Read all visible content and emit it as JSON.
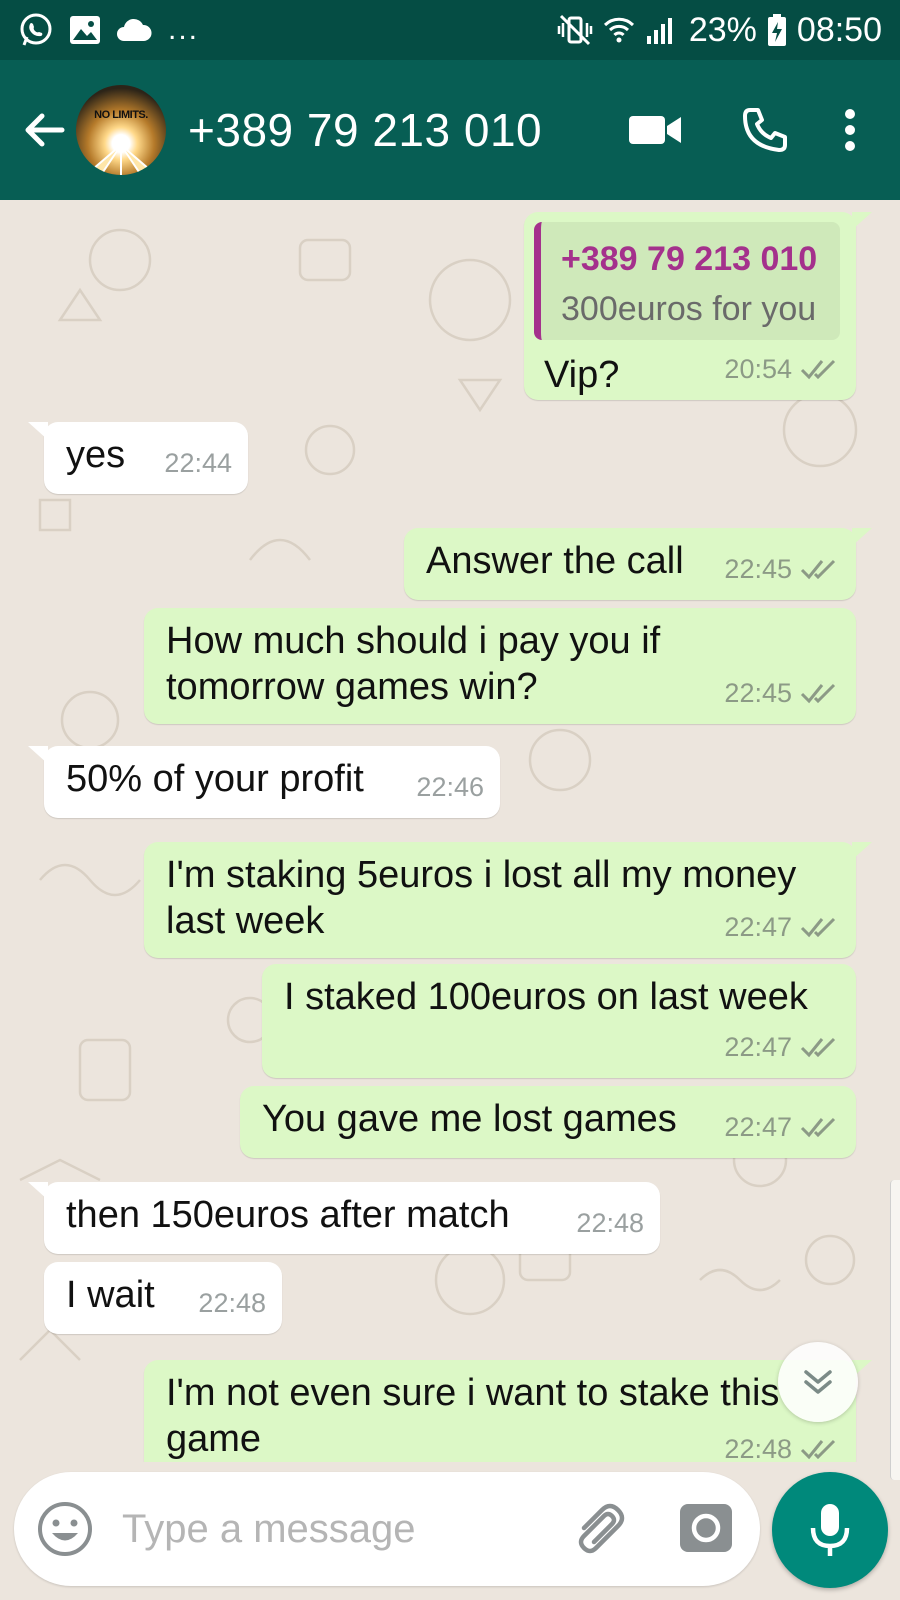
{
  "status_bar": {
    "left_icons": [
      "whatsapp-icon",
      "image-icon",
      "cloud-icon"
    ],
    "more": "...",
    "battery": "23%",
    "time": "08:50",
    "right_icons": [
      "mute-vibrate-icon",
      "wifi-icon",
      "signal-icon",
      "battery-charging-icon"
    ]
  },
  "header": {
    "back_icon": "arrow-left-icon",
    "avatar_text": "NO LIMITS.",
    "contact": "+389 79 213 010",
    "actions": [
      "video-call-icon",
      "phone-icon",
      "more-vert-icon"
    ]
  },
  "messages": [
    {
      "dir": "out",
      "quote": {
        "author": "+389 79 213 010",
        "text": "300euros for you"
      },
      "text": "Vip?",
      "time": "20:54",
      "ticks": true
    },
    {
      "dir": "in",
      "text": "yes",
      "time": "22:44"
    },
    {
      "dir": "out",
      "text": "Answer the call",
      "time": "22:45",
      "ticks": true
    },
    {
      "dir": "out",
      "text": "How much should i pay you if\ntomorrow games win?",
      "time": "22:45",
      "ticks": true
    },
    {
      "dir": "in",
      "text": "50% of your profit",
      "time": "22:46"
    },
    {
      "dir": "out",
      "text": "I'm staking 5euros i lost all my money\nlast week",
      "time": "22:47",
      "ticks": true
    },
    {
      "dir": "out",
      "text": "I staked 100euros on last week",
      "time": "22:47",
      "ticks": true
    },
    {
      "dir": "out",
      "text": "You gave me lost games",
      "time": "22:47",
      "ticks": true
    },
    {
      "dir": "in",
      "text": "then 150euros after match",
      "time": "22:48"
    },
    {
      "dir": "in",
      "text": "I wait",
      "time": "22:48"
    },
    {
      "dir": "out",
      "text": "I'm not even sure i want to stake this\ngame",
      "time": "22:48",
      "ticks": true
    }
  ],
  "composer": {
    "placeholder": "Type a message",
    "icons": [
      "emoji-icon",
      "paperclip-icon",
      "camera-icon",
      "microphone-icon"
    ]
  },
  "colors": {
    "status_bar": "#054D44",
    "app_bar": "#075E54",
    "outgoing_bubble": "#DCF8C6",
    "incoming_bubble": "#FFFFFF",
    "quote_accent": "#A4318C",
    "mic_button": "#00897B",
    "chat_background": "#ECE5DD"
  }
}
